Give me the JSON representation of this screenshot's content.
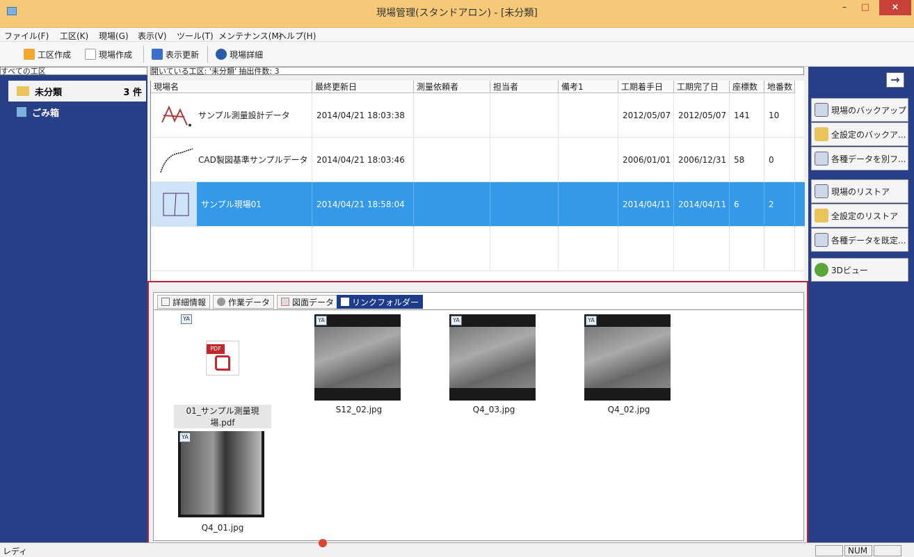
{
  "window": {
    "title": "現場管理(スタンドアロン) - [未分類]",
    "minimize": "–",
    "maximize": "□",
    "close": "×"
  },
  "menu": [
    "ファイル(F)",
    "工区(K)",
    "現場(G)",
    "表示(V)",
    "ツール(T)",
    "メンテナンス(M)",
    "ヘルプ(H)"
  ],
  "toolbar": {
    "create_area": "工区作成",
    "create_site": "現場作成",
    "refresh": "表示更新",
    "site_detail": "現場詳細"
  },
  "left_pane": {
    "header": "すべての工区",
    "items": [
      {
        "label": "未分類",
        "count": "3 件"
      },
      {
        "label": "ごみ箱"
      }
    ]
  },
  "grid": {
    "status": "開いている工区: '未分類'  抽出件数: 3",
    "columns": [
      "現場名",
      "最終更新日",
      "測量依頼者",
      "担当者",
      "備考1",
      "工期着手日",
      "工期完了日",
      "座標数",
      "地番数"
    ],
    "rows": [
      {
        "name": "サンプル測量設計データ",
        "updated": "2014/04/21 18:03:38",
        "requester": "",
        "person": "",
        "note": "",
        "start": "2012/05/07",
        "end": "2012/05/07",
        "coords": "141",
        "lots": "10"
      },
      {
        "name": "CAD製図基準サンプルデータ",
        "updated": "2014/04/21 18:03:46",
        "requester": "",
        "person": "",
        "note": "",
        "start": "2006/01/01",
        "end": "2006/12/31",
        "coords": "58",
        "lots": "0"
      },
      {
        "name": "サンプル現場01",
        "updated": "2014/04/21 18:58:04",
        "requester": "",
        "person": "",
        "note": "",
        "start": "2014/04/11",
        "end": "2014/04/11",
        "coords": "6",
        "lots": "2"
      }
    ],
    "selected_row": 2
  },
  "right_pane": {
    "buttons": [
      "現場のバックアップ",
      "全設定のバックア...",
      "各種データを別フ...",
      "現場のリストア",
      "全設定のリストア",
      "各種データを既定...",
      "3Dビュー"
    ]
  },
  "bottom": {
    "tabs": [
      "詳細情報",
      "作業データ",
      "図面データ",
      "リンクフォルダー"
    ],
    "active_tab": 3,
    "files": [
      "01_サンプル測量現場.pdf",
      "S12_02.jpg",
      "Q4_03.jpg",
      "Q4_02.jpg",
      "Q4_01.jpg"
    ],
    "pdf_label": "PDF",
    "badge": "YA"
  },
  "status": {
    "text": "レディ",
    "num": "NUM"
  },
  "colors": {
    "titlebar": "#f5c978",
    "pane": "#263f86",
    "selection": "#3399e8",
    "frame": "#b4253f"
  }
}
